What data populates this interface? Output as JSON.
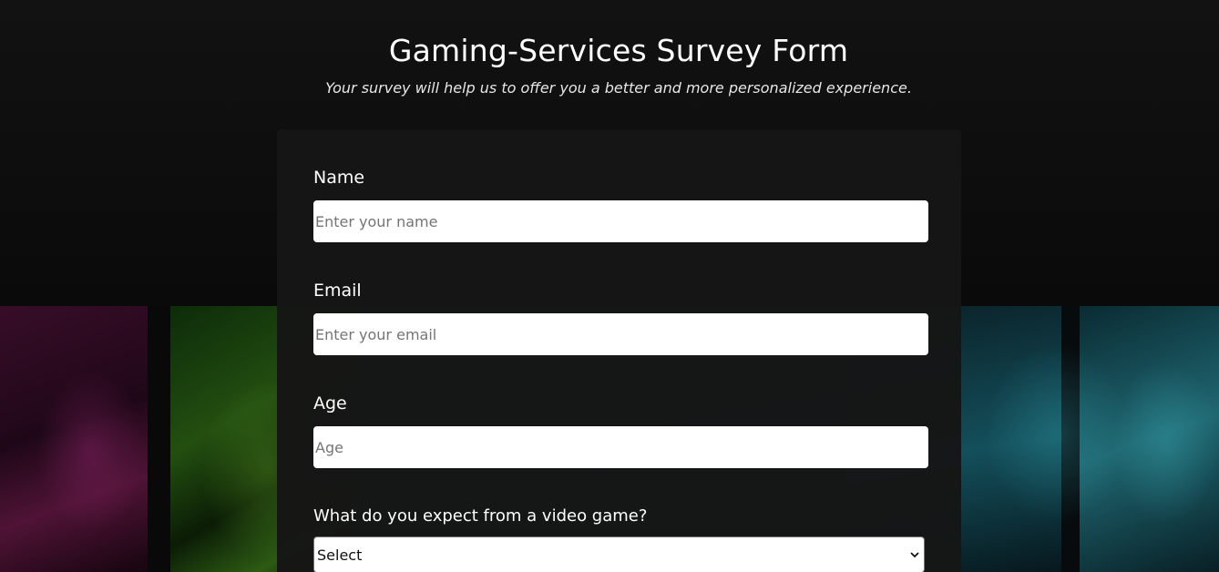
{
  "header": {
    "title": "Gaming-Services Survey Form",
    "subtitle": "Your survey will help us to offer you a better and more personalized experience."
  },
  "form": {
    "name": {
      "label": "Name",
      "placeholder": "Enter your name",
      "value": ""
    },
    "email": {
      "label": "Email",
      "placeholder": "Enter your email",
      "value": ""
    },
    "age": {
      "label": "Age",
      "placeholder": "Age",
      "value": ""
    },
    "expectation": {
      "label": "What do you expect from a video game?",
      "selected": "Select"
    }
  },
  "colors": {
    "background": "#0b0b0b",
    "card": "#161616",
    "text": "#ffffff",
    "input_bg": "#ffffff",
    "placeholder": "#757575"
  },
  "icons": {
    "select_arrow": "chevron-down-icon"
  }
}
